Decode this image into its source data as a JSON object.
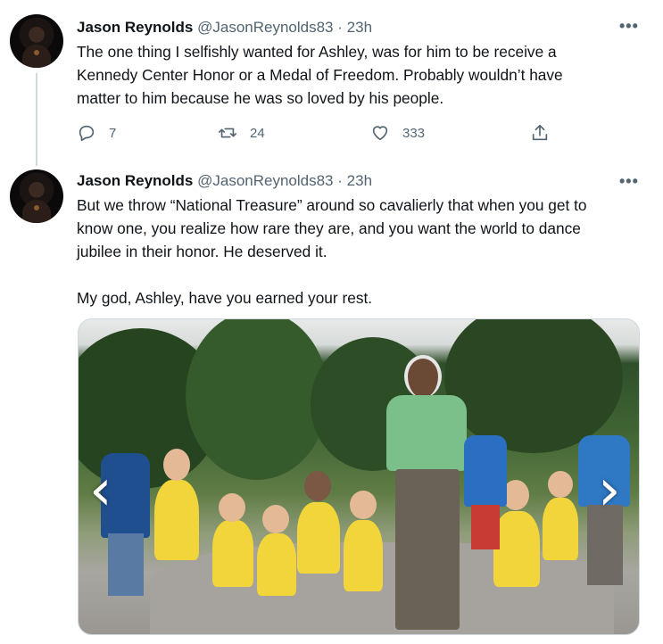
{
  "tweets": [
    {
      "author_name": "Jason Reynolds",
      "author_handle": "@JasonReynolds83",
      "separator": "·",
      "time": "23h",
      "text_lines": [
        "The one thing I selfishly wanted for Ashley, was for him to be receive a",
        "Kennedy Center Honor or a Medal of Freedom. Probably wouldn’t have",
        "matter to him because he was so loved by his people."
      ],
      "actions": {
        "reply_count": "7",
        "retweet_count": "24",
        "like_count": "333"
      }
    },
    {
      "author_name": "Jason Reynolds",
      "author_handle": "@JasonReynolds83",
      "separator": "·",
      "time": "23h",
      "text_lines": [
        "But we throw “National Treasure” around so cavalierly that when you get to",
        "know one, you realize how rare they are, and you want the world to dance",
        "jubilee in their honor. He deserved it.",
        "",
        "My god, Ashley, have you earned your rest."
      ]
    }
  ],
  "more_icon": "more-horizontal-icon",
  "icons": {
    "reply": "reply-icon",
    "retweet": "retweet-icon",
    "like": "heart-icon",
    "share": "share-icon",
    "prev": "chevron-left-icon",
    "next": "chevron-right-icon"
  },
  "colors": {
    "text": "#0f1419",
    "secondary": "#536471",
    "thread_line": "#cfd9de",
    "shirt_yellow": "#f1d53b"
  }
}
